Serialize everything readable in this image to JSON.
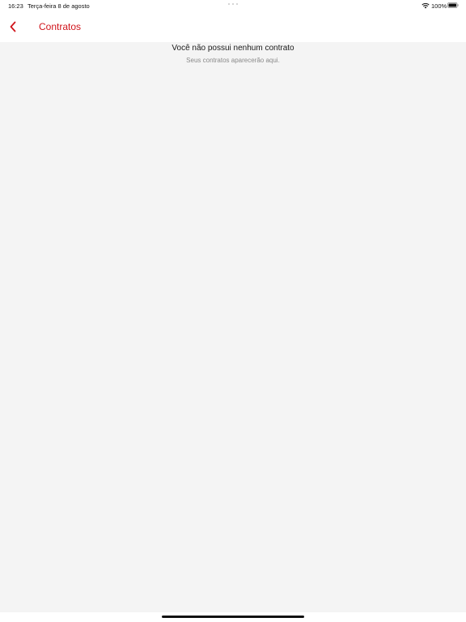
{
  "status_bar": {
    "time": "16:23",
    "date": "Terça-feira 8 de agosto",
    "battery_percent": "100%",
    "icons": [
      "wifi-icon",
      "battery-icon"
    ]
  },
  "nav": {
    "title": "Contratos",
    "back_icon": "chevron-left-icon",
    "accent_color": "#d0141b"
  },
  "empty_state": {
    "title": "Você não possui nenhum contrato",
    "subtitle": "Seus contratos aparecerão aqui."
  },
  "colors": {
    "content_background": "#f4f4f4",
    "nav_background": "#ffffff"
  }
}
